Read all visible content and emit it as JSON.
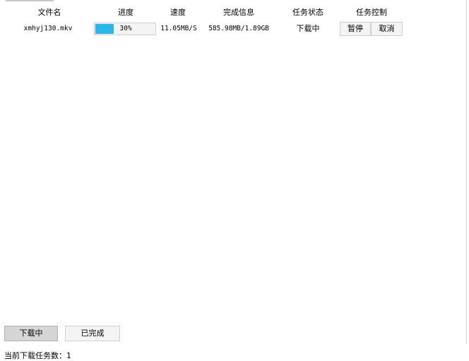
{
  "header": {
    "columns": [
      "文件名",
      "进度",
      "速度",
      "完成信息",
      "任务状态",
      "任务控制"
    ]
  },
  "tasks": [
    {
      "filename": "xmhyj130.mkv",
      "progress_label": "30%",
      "progress_value": 0.3,
      "speed": "11.05MB/S",
      "completion_info": "585.98MB/1.89GB",
      "status": "下载中",
      "pause_label": "暂停",
      "cancel_label": "取消"
    }
  ],
  "bottom_tabs": {
    "downloading_label": "下载中",
    "completed_label": "已完成"
  },
  "status_bar": {
    "text": "当前下载任务数：1"
  },
  "colors": {
    "progress_fill": "#29b6e8",
    "active_tab_bg": "#d6d6d6",
    "button_bg": "#f4f4f4",
    "border": "#cfcfcf"
  }
}
